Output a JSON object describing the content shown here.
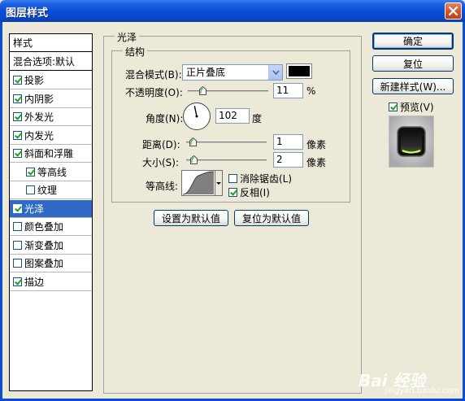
{
  "window": {
    "title": "图层样式"
  },
  "styles_list": {
    "header": "样式",
    "blend_options": "混合选项:默认",
    "items": [
      {
        "label": "投影",
        "checked": true,
        "sub": false,
        "selected": false
      },
      {
        "label": "内阴影",
        "checked": true,
        "sub": false,
        "selected": false
      },
      {
        "label": "外发光",
        "checked": true,
        "sub": false,
        "selected": false
      },
      {
        "label": "内发光",
        "checked": true,
        "sub": false,
        "selected": false
      },
      {
        "label": "斜面和浮雕",
        "checked": true,
        "sub": false,
        "selected": false
      },
      {
        "label": "等高线",
        "checked": true,
        "sub": true,
        "selected": false
      },
      {
        "label": "纹理",
        "checked": false,
        "sub": true,
        "selected": false
      },
      {
        "label": "光泽",
        "checked": true,
        "sub": false,
        "selected": true
      },
      {
        "label": "颜色叠加",
        "checked": false,
        "sub": false,
        "selected": false
      },
      {
        "label": "渐变叠加",
        "checked": false,
        "sub": false,
        "selected": false
      },
      {
        "label": "图案叠加",
        "checked": false,
        "sub": false,
        "selected": false
      },
      {
        "label": "描边",
        "checked": true,
        "sub": false,
        "selected": false
      }
    ]
  },
  "satin": {
    "group_title": "光泽",
    "structure_title": "结构",
    "blend_mode_label": "混合模式(B):",
    "blend_mode_value": "正片叠底",
    "color": "#000000",
    "opacity_label": "不透明度(O):",
    "opacity_value": "11",
    "opacity_unit": "%",
    "opacity_fraction": 0.11,
    "angle_label": "角度(N):",
    "angle_value": "102",
    "angle_unit": "度",
    "distance_label": "距离(D):",
    "distance_value": "1",
    "distance_unit": "像素",
    "distance_fraction": 0.004,
    "size_label": "大小(S):",
    "size_value": "2",
    "size_unit": "像素",
    "size_fraction": 0.008,
    "contour_label": "等高线:",
    "antialias_label": "消除锯齿(L)",
    "antialias_checked": false,
    "invert_label": "反相(I)",
    "invert_checked": true,
    "make_default_button": "设置为默认值",
    "reset_default_button": "复位为默认值"
  },
  "right_panel": {
    "ok_button": "确定",
    "reset_button": "复位",
    "new_style_button": "新建样式(W)...",
    "preview_label": "预览(V)",
    "preview_checked": true
  },
  "watermark": {
    "brand": "Bai 经验",
    "url": "jingyan.baidu.com"
  }
}
